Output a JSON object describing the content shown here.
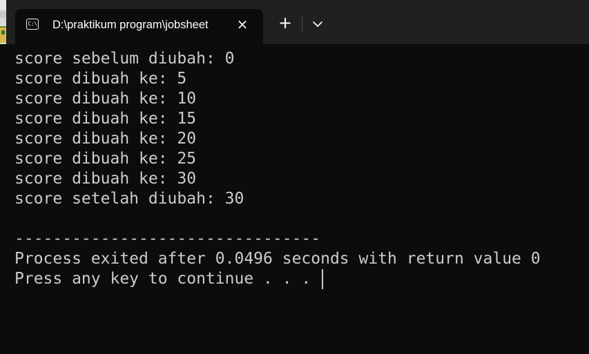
{
  "tab": {
    "icon": "terminal-icon",
    "icon_text": "C:\\",
    "title": "D:\\praktikum program\\jobsheet",
    "close_icon": "close-icon"
  },
  "toolbar": {
    "new_tab_icon": "plus-icon",
    "dropdown_icon": "chevron-down-icon"
  },
  "console": {
    "lines": [
      "score sebelum diubah: 0",
      "score dibuah ke: 5",
      "score dibuah ke: 10",
      "score dibuah ke: 15",
      "score dibuah ke: 20",
      "score dibuah ke: 25",
      "score dibuah ke: 30",
      "score setelah diubah: 30",
      "",
      "--------------------------------",
      "Process exited after 0.0496 seconds with return value 0",
      "Press any key to continue . . . "
    ]
  },
  "colors": {
    "titlebar": "#202020",
    "background": "#0c0c0c",
    "text": "#cccccc"
  }
}
